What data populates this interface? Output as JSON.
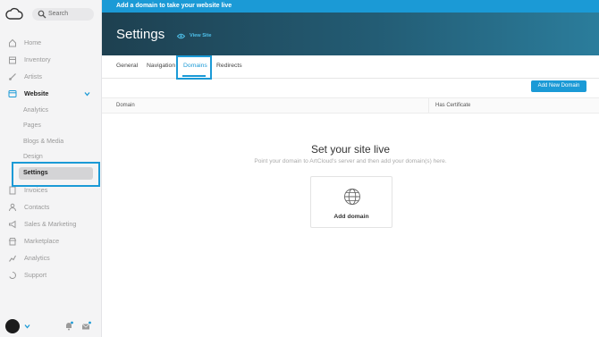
{
  "colors": {
    "accent": "#1b9ad6",
    "header_start": "#1e4050",
    "header_end": "#2b7d9c",
    "sidebar_bg": "#f4f4f5"
  },
  "banner": {
    "text": "Add a domain to take your website live"
  },
  "sidebar": {
    "logo_icon": "cloud-icon",
    "search_placeholder": "Search",
    "nav": [
      {
        "label": "Home",
        "icon": "home-icon"
      },
      {
        "label": "Inventory",
        "icon": "inventory-icon"
      },
      {
        "label": "Artists",
        "icon": "brush-icon"
      },
      {
        "label": "Website",
        "icon": "browser-icon"
      },
      {
        "label": "Invoices",
        "icon": "invoice-icon"
      },
      {
        "label": "Contacts",
        "icon": "person-icon"
      },
      {
        "label": "Sales & Marketing",
        "icon": "megaphone-icon"
      },
      {
        "label": "Marketplace",
        "icon": "store-icon"
      },
      {
        "label": "Analytics",
        "icon": "chart-icon"
      },
      {
        "label": "Support",
        "icon": "support-icon"
      }
    ],
    "website_sub": [
      "Analytics",
      "Pages",
      "Blogs & Media",
      "Design",
      "Settings"
    ]
  },
  "header": {
    "title": "Settings",
    "view_site": "View Site"
  },
  "tabs": [
    "General",
    "Navigation",
    "Domains",
    "Redirects"
  ],
  "active_tab": "Domains",
  "add_button": "Add New Domain",
  "table": {
    "columns": [
      "Domain",
      "Has Certificate"
    ]
  },
  "empty_state": {
    "title": "Set your site live",
    "subtitle": "Point your domain to ArtCloud's server and then add your domain(s) here.",
    "card_label": "Add domain"
  }
}
